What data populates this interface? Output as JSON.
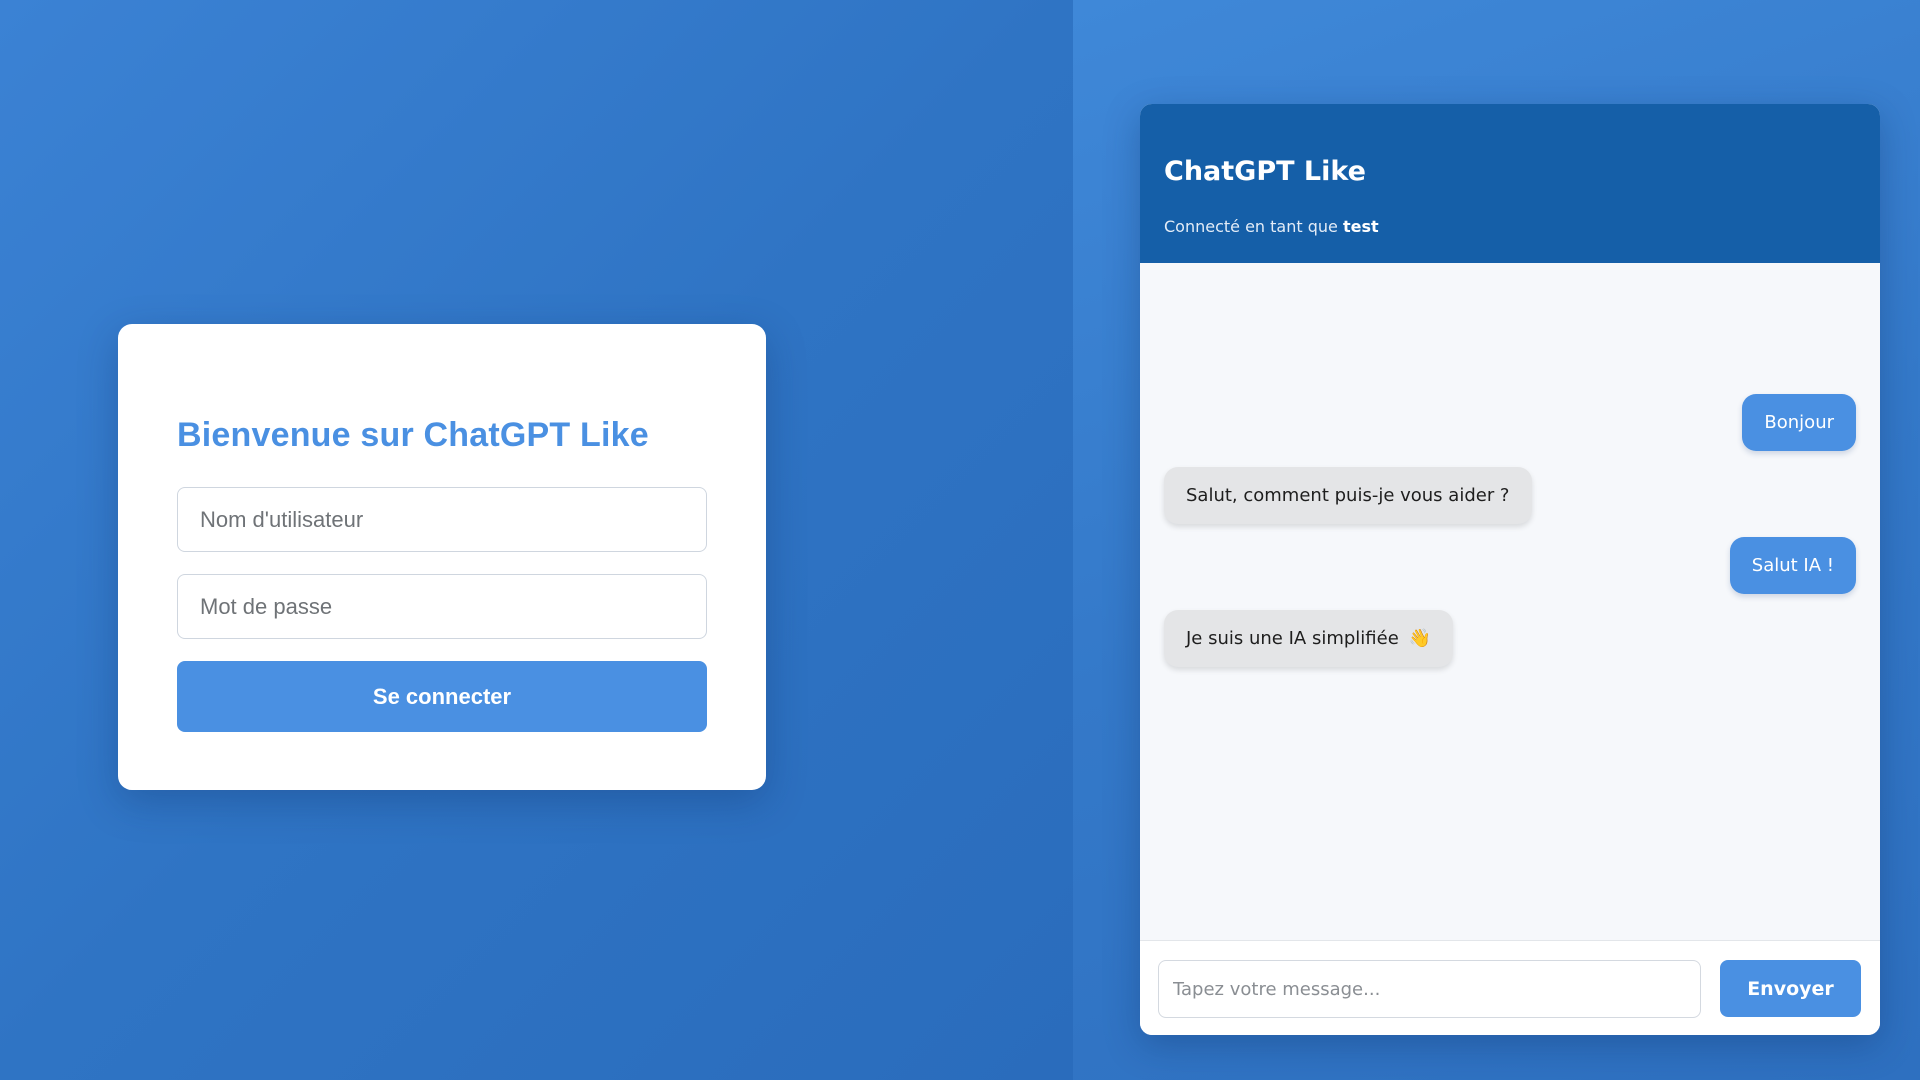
{
  "login": {
    "title": "Bienvenue sur ChatGPT Like",
    "username_placeholder": "Nom d'utilisateur",
    "password_placeholder": "Mot de passe",
    "submit_label": "Se connecter"
  },
  "chat": {
    "title": "ChatGPT Like",
    "status_prefix": "Connecté en tant que",
    "username": "test",
    "messages": [
      {
        "role": "user",
        "text": "Bonjour"
      },
      {
        "role": "bot",
        "text": "Salut, comment puis-je vous aider ?"
      },
      {
        "role": "user",
        "text": "Salut IA !"
      },
      {
        "role": "bot",
        "text": "Je suis une IA simplifiée",
        "emoji": "👋"
      }
    ],
    "input_placeholder": "Tapez votre message...",
    "send_label": "Envoyer"
  },
  "colors": {
    "accent": "#4a90e2",
    "header": "#155fa8",
    "background": "#3179c8",
    "bot_bubble": "#e4e5e7"
  }
}
